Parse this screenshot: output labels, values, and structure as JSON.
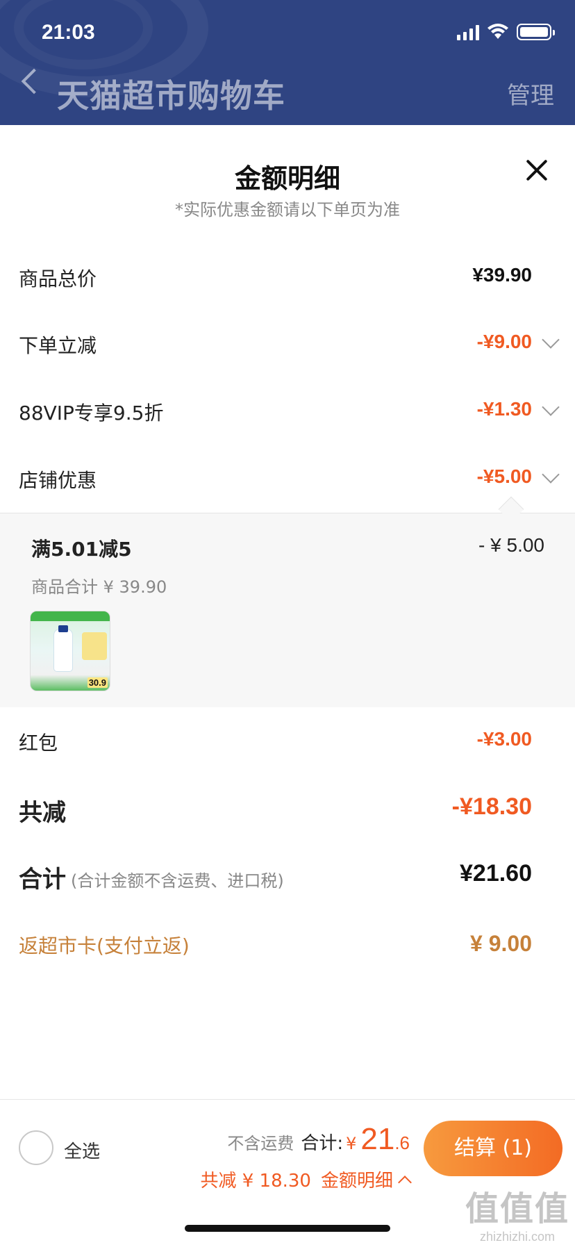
{
  "status_bar": {
    "time": "21:03"
  },
  "nav": {
    "title": "天猫超市购物车",
    "manage": "管理"
  },
  "sheet": {
    "title": "金额明细",
    "subtitle": "*实际优惠金额请以下单页为准",
    "rows": {
      "goods_total": {
        "label": "商品总价",
        "value": "¥39.90"
      },
      "order_discount": {
        "label": "下单立减",
        "value": "-¥9.00"
      },
      "vip": {
        "label": "88VIP专享9.5折",
        "value": "-¥1.30"
      },
      "shop": {
        "label": "店铺优惠",
        "value": "-¥5.00"
      },
      "red_packet": {
        "label": "红包",
        "value": "-¥3.00"
      },
      "total_reduce": {
        "label": "共减",
        "value": "-¥18.30"
      },
      "total": {
        "label": "合计",
        "note": "(合计金额不含运费、进口税)",
        "value": "¥21.60"
      },
      "return_card": {
        "label": "返超市卡(支付立返)",
        "value": "¥ 9.00"
      }
    },
    "shop_detail": {
      "name": "满5.01减5",
      "amount": "- ¥ 5.00",
      "subtotal": "商品合计 ¥ 39.90",
      "thumb_price": "30.9"
    }
  },
  "bottom_bar": {
    "select_all": "全选",
    "shipping_note": "不含运费",
    "sum_label": "合计:",
    "sum_currency": "¥",
    "sum_int": "21",
    "sum_dec": ".6",
    "reduce_text": "共减 ¥ 18.30",
    "detail_link": "金额明细",
    "checkout": "结算 (1)"
  },
  "watermark": {
    "mark": "值值值",
    "url": "zhizhizhi.com"
  },
  "colors": {
    "header_bg": "#2f4482",
    "accent_orange": "#f05a22",
    "return_gold": "#c6813a"
  },
  "icons": [
    "back-arrow-icon",
    "close-icon",
    "chevron-down-icon",
    "chevron-up-icon",
    "signal-icon",
    "wifi-icon",
    "battery-icon"
  ]
}
